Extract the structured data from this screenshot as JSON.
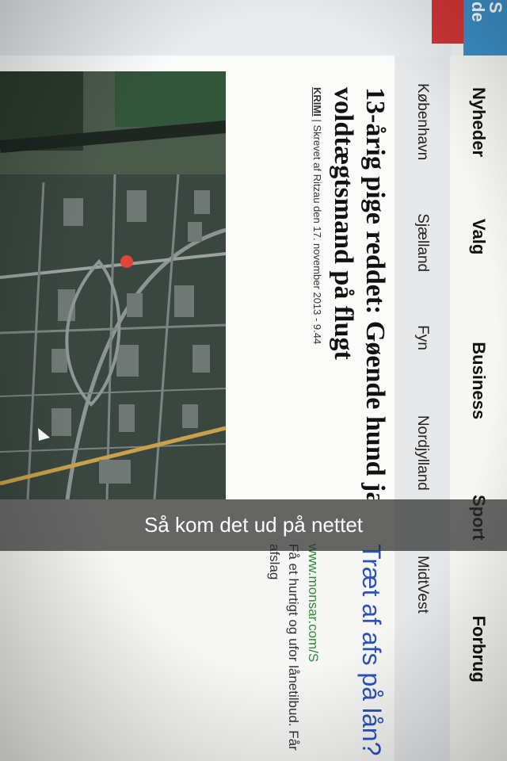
{
  "logo": {
    "text": "S\nde"
  },
  "nav": {
    "items": [
      "Nyheder",
      "Valg",
      "Business",
      "Sport",
      "Forbrug"
    ]
  },
  "subnav": {
    "items": [
      "København",
      "Sjælland",
      "Fyn",
      "Nordjylland",
      "MidtVest"
    ]
  },
  "article": {
    "headline": "13-årig pige reddet: Gøende hund jager voldtægtsmand på flugt",
    "category": "KRIMI",
    "byline_rest": "| Skrevet af Ritzau den 17. november 2013 - 9.44"
  },
  "ad": {
    "title": "Træt af afs på lån?",
    "url": "www.monsar.com/S",
    "text": "Få et hurtigt og ufor lånetilbud. Får afslag"
  },
  "caption": {
    "text": "Så kom det ud på nettet"
  },
  "colors": {
    "logo_red": "#cf3535",
    "logo_blue": "#3c8fc7",
    "ad_link": "#2a52b8",
    "ad_url": "#2f8a3c"
  }
}
